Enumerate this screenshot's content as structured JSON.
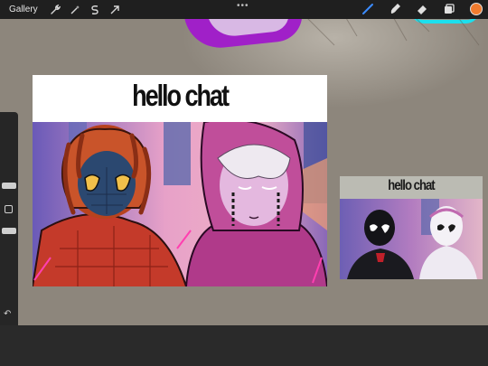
{
  "toolbar": {
    "gallery_label": "Gallery",
    "left_icons": [
      "wrench-icon",
      "magic-wand-icon",
      "selection-s-icon",
      "transform-arrow-icon"
    ],
    "more_icon": "more-dots-icon",
    "right_icons": [
      "brush-icon",
      "smudge-icon",
      "eraser-icon",
      "layers-icon"
    ],
    "current_color": "#f07b2e"
  },
  "sidebar": {
    "undo_icon": "undo-icon",
    "redo_icon": "redo-icon",
    "modify_icon": "square-modify-icon"
  },
  "artwork_main": {
    "title": "hello chat"
  },
  "artwork_small": {
    "title": "hello chat"
  },
  "colors": {
    "canvas": "#8d867c",
    "toolbar": "#1f1f1f",
    "accent_purple": "#a020c8",
    "accent_cyan": "#1ce0ee"
  }
}
